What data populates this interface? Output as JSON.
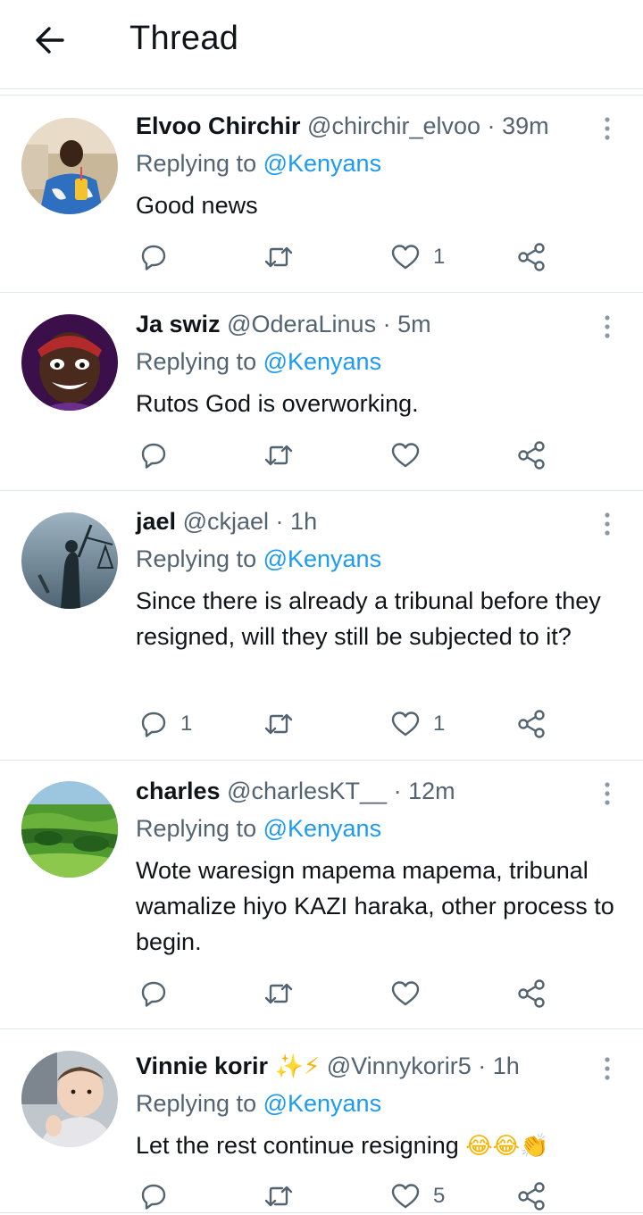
{
  "header": {
    "title": "Thread"
  },
  "reply_prefix": "Replying to ",
  "tweets": [
    {
      "name": "Elvoo Chirchir",
      "handle": "@chirchir_elvoo",
      "time": "39m",
      "reply_to": "@Kenyans",
      "text": "Good news",
      "replies": "",
      "retweets": "",
      "likes": "1"
    },
    {
      "name": "Ja swiz",
      "handle": "@OderaLinus",
      "time": "5m",
      "reply_to": "@Kenyans",
      "text": "Rutos God is overworking.",
      "replies": "",
      "retweets": "",
      "likes": ""
    },
    {
      "name": "jael",
      "handle": "@ckjael",
      "time": "1h",
      "reply_to": "@Kenyans",
      "text": "Since there is already a tribunal before they resigned, will they still be subjected to it?",
      "replies": "1",
      "retweets": "",
      "likes": "1"
    },
    {
      "name": "charles",
      "handle": "@charlesKT__",
      "time": "12m",
      "reply_to": "@Kenyans",
      "text": "Wote waresign mapema mapema, tribunal wamalize hiyo KAZI haraka, other process to begin.",
      "replies": "",
      "retweets": "",
      "likes": ""
    },
    {
      "name": "Vinnie korir",
      "name_emoji": "✨⚡",
      "handle": "@Vinnykorir5",
      "time": "1h",
      "reply_to": "@Kenyans",
      "text": "Let the rest continue resigning",
      "text_emoji": "😂😂👏",
      "replies": "",
      "retweets": "",
      "likes": "5"
    }
  ],
  "colors": {
    "text": "#0f1419",
    "secondary": "#536471",
    "mention": "#1d9bf0",
    "divider": "#e1e6ea"
  },
  "icons": {
    "back": "arrow-left-icon",
    "more": "more-vertical-icon",
    "reply": "reply-icon",
    "retweet": "retweet-icon",
    "like": "heart-icon",
    "share": "share-icon"
  }
}
